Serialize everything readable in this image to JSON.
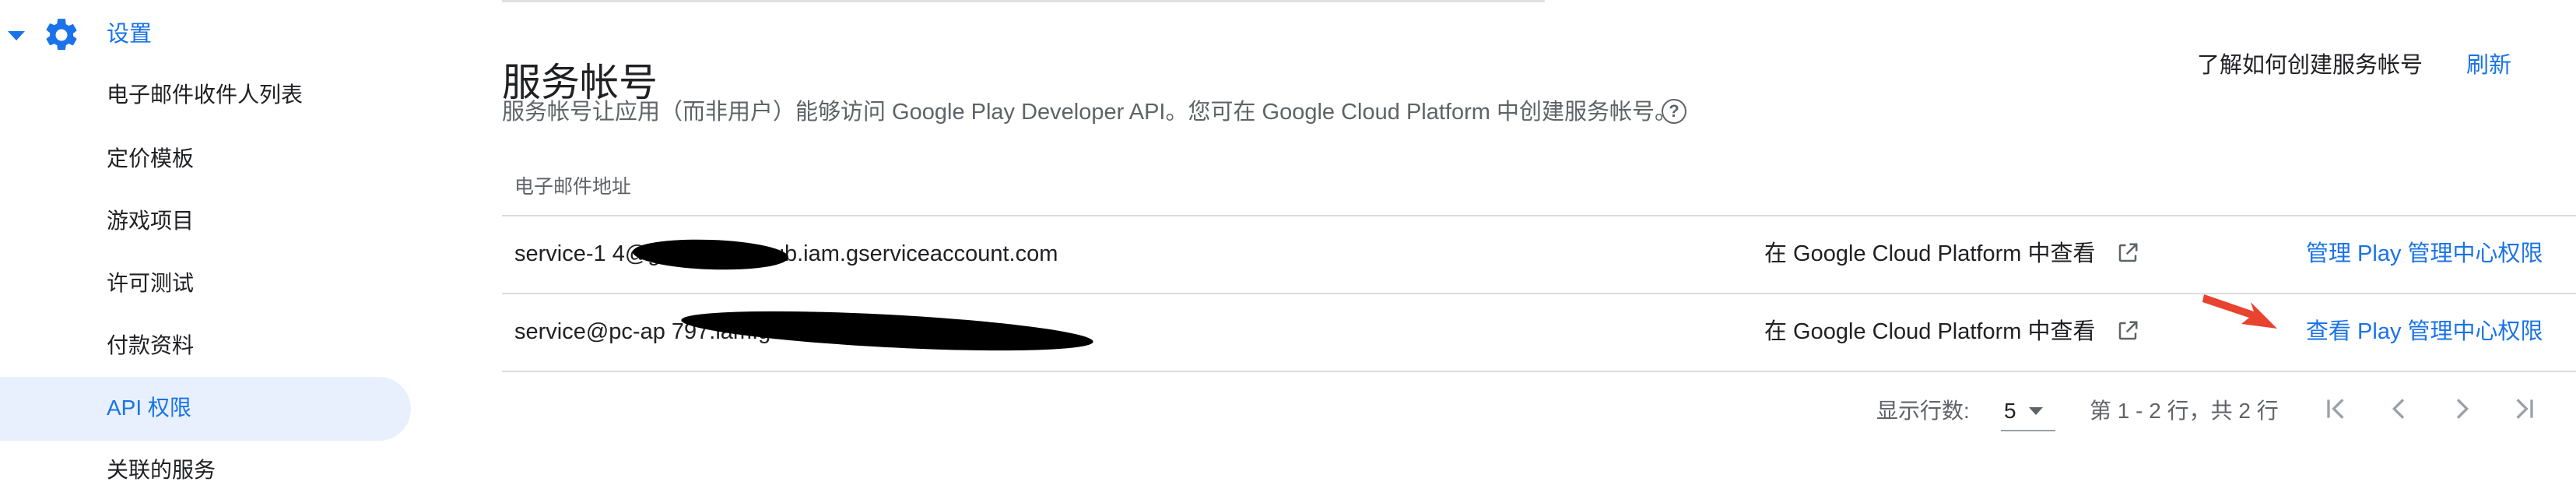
{
  "sidebar": {
    "settings_label": "设置",
    "items": [
      {
        "label": "电子邮件收件人列表"
      },
      {
        "label": "定价模板"
      },
      {
        "label": "游戏项目"
      },
      {
        "label": "许可测试"
      },
      {
        "label": "付款资料"
      },
      {
        "label": "API 权限",
        "active": true
      },
      {
        "label": "关联的服务"
      }
    ]
  },
  "header": {
    "title": "服务帐号",
    "learn_link": "了解如何创建服务帐号",
    "refresh": "刷新",
    "description": "服务帐号让应用（而非用户）能够访问 Google Play Developer API。您可在 Google Cloud Platform 中创建服务帐号。",
    "help_icon": "?"
  },
  "table": {
    "column_header": "电子邮件地址",
    "rows": [
      {
        "email": "service-1            4@gcp-sa-pubsub.iam.gserviceaccount.com",
        "gcp_link": "在 Google Cloud Platform 中查看",
        "permission_link": "管理 Play 管理中心权限"
      },
      {
        "email": "service@pc-ap                                    797.iam.gserviceaccount.com",
        "gcp_link": "在 Google Cloud Platform 中查看",
        "permission_link": "查看 Play 管理中心权限"
      }
    ]
  },
  "pagination": {
    "rows_label": "显示行数:",
    "rows_value": "5",
    "range_text": "第 1 - 2 行，共 2 行"
  },
  "colors": {
    "accent": "#1a73e8",
    "active_bg": "#e8f0fe",
    "arrow": "#e8432e"
  },
  "icons": [
    "chevron-down-icon",
    "gear-icon",
    "help-icon",
    "open-in-new-icon",
    "red-arrow-annotation",
    "first-page-icon",
    "previous-page-icon",
    "next-page-icon",
    "last-page-icon"
  ]
}
